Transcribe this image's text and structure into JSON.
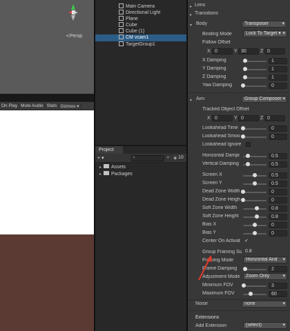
{
  "scene": {
    "persp_label": "≺Persp"
  },
  "game_toolbar": {
    "items": [
      "On Play",
      "Mute Audio",
      "Stats",
      "Gizmos ▾"
    ]
  },
  "hierarchy": {
    "items": [
      {
        "label": "Main Camera",
        "selected": false
      },
      {
        "label": "Directional Light",
        "selected": false
      },
      {
        "label": "Plane",
        "selected": false
      },
      {
        "label": "Cube",
        "selected": false
      },
      {
        "label": "Cube (1)",
        "selected": false
      },
      {
        "label": "CM vcam1",
        "selected": true
      },
      {
        "label": "TargetGroup1",
        "selected": false
      }
    ]
  },
  "project": {
    "tab_label": "Project",
    "add_label": "+ ▾",
    "count_label": "10",
    "folders": [
      "Assets",
      "Packages"
    ]
  },
  "inspector": {
    "lens_label": "Lens",
    "transitions_label": "Transitions",
    "body": {
      "label": "Body",
      "value": "Transposer",
      "binding_mode_label": "Binding Mode",
      "binding_mode_value": "Lock To Target ▾",
      "follow_offset_label": "Follow Offset",
      "follow_offset": {
        "x": "0",
        "y": "30",
        "z": "0"
      },
      "dampings": [
        {
          "label": "X Damping",
          "value": "1",
          "fraction": 0.1
        },
        {
          "label": "Y Damping",
          "value": "1",
          "fraction": 0.1
        },
        {
          "label": "Z Damping",
          "value": "1",
          "fraction": 0.1
        },
        {
          "label": "Yaw Damping",
          "value": "0",
          "fraction": 0.0
        }
      ]
    },
    "aim": {
      "label": "Aim",
      "value": "Group Composer",
      "tracked_offset_label": "Tracked Object Offset",
      "tracked_offset": {
        "x": "0",
        "y": "0",
        "z": "0"
      },
      "lookahead": [
        {
          "label": "Lookahead Time",
          "value": "0",
          "fraction": 0.0
        },
        {
          "label": "Lookahead Smoo",
          "value": "0",
          "fraction": 0.0
        }
      ],
      "lookahead_ignore_label": "Lookahead Ignore",
      "damping": [
        {
          "label": "Horizontal Dampi",
          "value": "0.5",
          "fraction": 0.2
        },
        {
          "label": "Vertical Damping",
          "value": "0.5",
          "fraction": 0.2
        }
      ],
      "screen": [
        {
          "label": "Screen X",
          "value": "0.5",
          "fraction": 0.5
        },
        {
          "label": "Screen Y",
          "value": "0.5",
          "fraction": 0.5
        }
      ],
      "zones": [
        {
          "label": "Dead Zone Width",
          "value": "0",
          "fraction": 0.0
        },
        {
          "label": "Dead Zone Heigh",
          "value": "0",
          "fraction": 0.0
        },
        {
          "label": "Soft Zone Width",
          "value": "0.8",
          "fraction": 0.6
        },
        {
          "label": "Soft Zone Height",
          "value": "0.8",
          "fraction": 0.6
        },
        {
          "label": "Bias X",
          "value": "0",
          "fraction": 0.5
        },
        {
          "label": "Bias Y",
          "value": "0",
          "fraction": 0.5
        }
      ],
      "center_on_activate_label": "Center On Activat",
      "center_on_activate_check": "✓",
      "group_framing_size_label": "Group Framing Siz",
      "group_framing_size_value": "0.8",
      "framing_mode_label": "Framing Mode",
      "framing_mode_value": "Horizontal And",
      "frame_damping_label": "Frame Damping",
      "frame_damping_value": "2",
      "frame_damping_fraction": 0.1,
      "adjustment_mode_label": "Adjustment Mode",
      "adjustment_mode_value": "Zoom Only",
      "min_fov_label": "Minimum FOV",
      "min_fov_value": "3",
      "min_fov_fraction": 0.02,
      "max_fov_label": "Maximum FOV",
      "max_fov_value": "60",
      "max_fov_fraction": 0.33
    },
    "noise": {
      "label": "Noise",
      "value": "none"
    },
    "extensions": {
      "label": "Extensions",
      "add_label": "Add Extension",
      "add_value": "(select)"
    }
  }
}
